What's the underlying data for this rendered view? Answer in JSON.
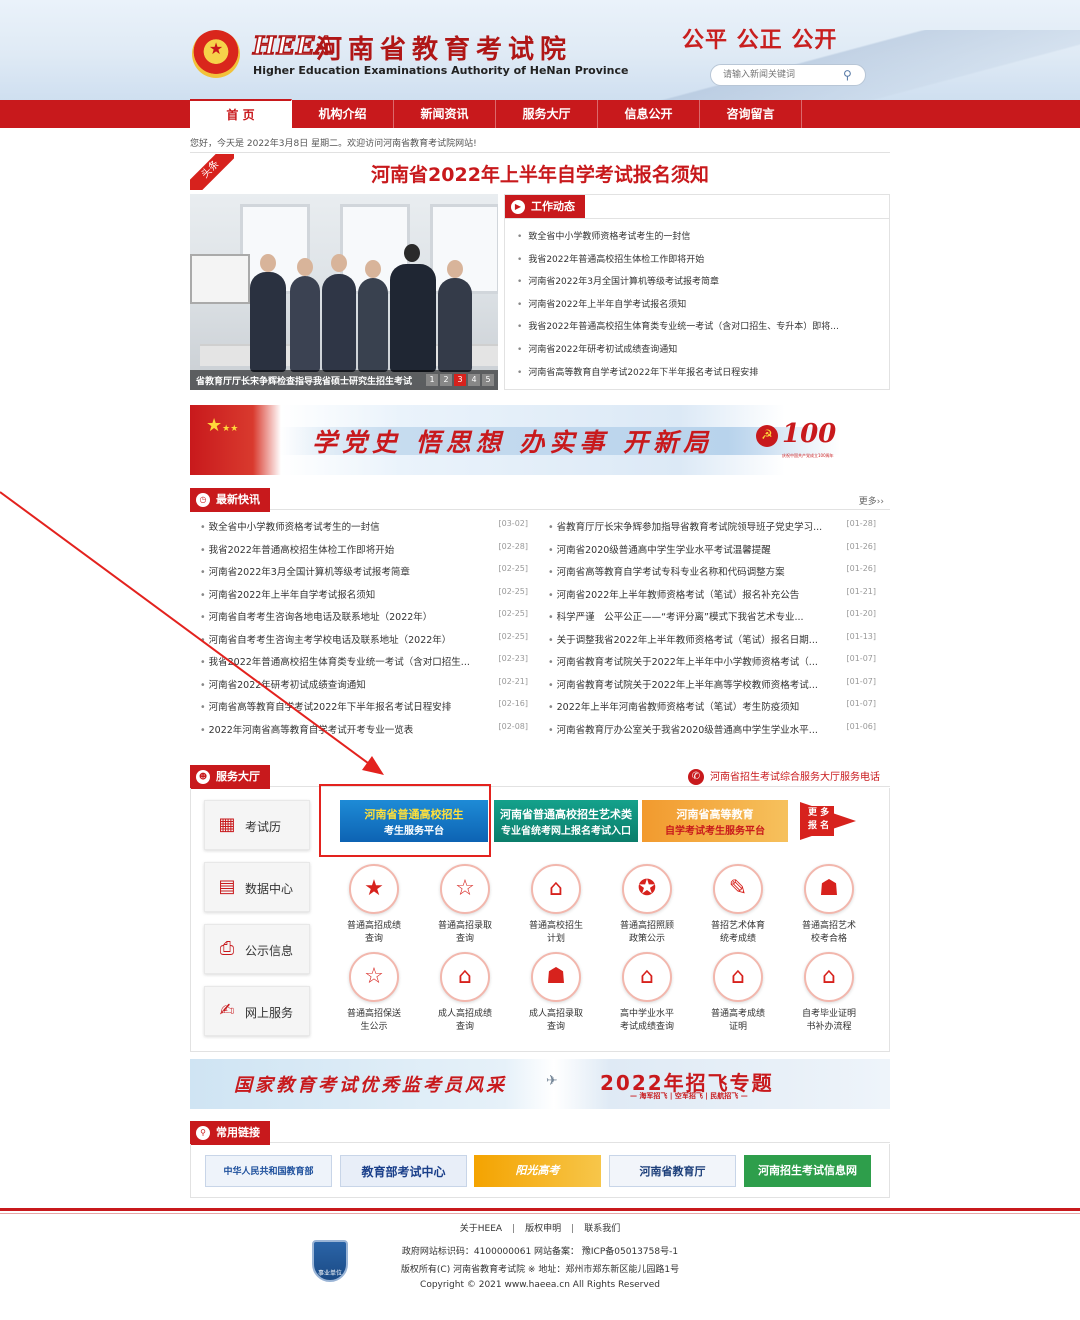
{
  "header": {
    "logo_abbr": "HEEA",
    "logo_cn": "河南省教育考试院",
    "logo_en": "Higher Education Examinations Authority of HeNan Province",
    "slogan": "公平 公正 公开",
    "search_placeholder": "请输入新闻关键词"
  },
  "nav": [
    "首 页",
    "机构介绍",
    "新闻资讯",
    "服务大厅",
    "信息公开",
    "咨询留言"
  ],
  "welcome": "您好，今天是 2022年3月8日 星期二。欢迎访问河南省教育考试院网站!",
  "headline": {
    "ribbon": "头条",
    "title": "河南省2022年上半年自学考试报名须知"
  },
  "slider": {
    "caption": "省教育厅厅长宋争辉检查指导我省硕士研究生招生考试",
    "pages": [
      "1",
      "2",
      "3",
      "4",
      "5"
    ],
    "active_page": 3
  },
  "work_news": {
    "title": "工作动态",
    "items": [
      "致全省中小学教师资格考试考生的一封信",
      "我省2022年普通高校招生体检工作即将开始",
      "河南省2022年3月全国计算机等级考试报考简章",
      "河南省2022年上半年自学考试报名须知",
      "我省2022年普通高校招生体育类专业统一考试（含对口招生、专升本）即将...",
      "河南省2022年研考初试成绩查询通知",
      "河南省高等教育自学考试2022年下半年报名考试日程安排"
    ]
  },
  "banner_slogan": "学党史 悟思想 办实事 开新局",
  "banner_badge": {
    "number": "100",
    "caption": "庆祝中国共产党成立100周年"
  },
  "latest_news": {
    "title": "最新快讯",
    "more": "更多››",
    "left": [
      {
        "title": "致全省中小学教师资格考试考生的一封信",
        "date": "[03-02]"
      },
      {
        "title": "我省2022年普通高校招生体检工作即将开始",
        "date": "[02-28]"
      },
      {
        "title": "河南省2022年3月全国计算机等级考试报考简章",
        "date": "[02-25]"
      },
      {
        "title": "河南省2022年上半年自学考试报名须知",
        "date": "[02-25]"
      },
      {
        "title": "河南省自考考生咨询各地电话及联系地址（2022年）",
        "date": "[02-25]"
      },
      {
        "title": "河南省自考考生咨询主考学校电话及联系地址（2022年）",
        "date": "[02-25]"
      },
      {
        "title": "我省2022年普通高校招生体育类专业统一考试（含对口招生...",
        "date": "[02-23]"
      },
      {
        "title": "河南省2022年研考初试成绩查询通知",
        "date": "[02-21]"
      },
      {
        "title": "河南省高等教育自学考试2022年下半年报名考试日程安排",
        "date": "[02-16]"
      },
      {
        "title": "2022年河南省高等教育自学考试开考专业一览表",
        "date": "[02-08]"
      }
    ],
    "right": [
      {
        "title": "省教育厅厅长宋争辉参加指导省教育考试院领导班子党史学习...",
        "date": "[01-28]"
      },
      {
        "title": "河南省2020级普通高中学生学业水平考试温馨提醒",
        "date": "[01-26]"
      },
      {
        "title": "河南省高等教育自学考试专科专业名称和代码调整方案",
        "date": "[01-26]"
      },
      {
        "title": "河南省2022年上半年教师资格考试（笔试）报名补充公告",
        "date": "[01-21]"
      },
      {
        "title": "科学严谨　公平公正——“考评分离”模式下我省艺术专业...",
        "date": "[01-20]"
      },
      {
        "title": "关于调整我省2022年上半年教师资格考试（笔试）报名日期...",
        "date": "[01-13]"
      },
      {
        "title": "河南省教育考试院关于2022年上半年中小学教师资格考试（...",
        "date": "[01-07]"
      },
      {
        "title": "河南省教育考试院关于2022年上半年高等学校教师资格考试...",
        "date": "[01-07]"
      },
      {
        "title": "2022年上半年河南省教师资格考试（笔试）考生防疫须知",
        "date": "[01-07]"
      },
      {
        "title": "河南省教育厅办公室关于我省2020级普通高中学生学业水平...",
        "date": "[01-06]"
      }
    ]
  },
  "service_hall": {
    "title": "服务大厅",
    "phone": "河南省招生考试综合服务大厅服务电话",
    "side_buttons": [
      "考试历",
      "数据中心",
      "公示信息",
      "网上服务"
    ],
    "platforms": [
      {
        "line1": "河南省普通高校招生",
        "line2": "考生服务平台"
      },
      {
        "line1": "河南省普通高校招生艺术类",
        "line2": "专业省统考网上报名考试入口"
      },
      {
        "line1": "河南省高等教育",
        "line2": "自学考试考生服务平台"
      }
    ],
    "more": "更 多 报 名",
    "services": [
      {
        "name1": "普通高招成绩",
        "name2": "查询",
        "icon": "star-icon"
      },
      {
        "name1": "普通高招录取",
        "name2": "查询",
        "icon": "star-outline-icon"
      },
      {
        "name1": "普通高校招生",
        "name2": "计划",
        "icon": "building-icon"
      },
      {
        "name1": "普通高招照顾",
        "name2": "政策公示",
        "icon": "star-icon"
      },
      {
        "name1": "普招艺术体育",
        "name2": "统考成绩",
        "icon": "edit-icon"
      },
      {
        "name1": "普通高招艺术",
        "name2": "校考合格",
        "icon": "group-icon"
      },
      {
        "name1": "普通高招保送",
        "name2": "生公示",
        "icon": "star-outline-icon"
      },
      {
        "name1": "成人高招成绩",
        "name2": "查询",
        "icon": "building-icon"
      },
      {
        "name1": "成人高招录取",
        "name2": "查询",
        "icon": "group-icon"
      },
      {
        "name1": "高中学业水平",
        "name2": "考试成绩查询",
        "icon": "building-icon"
      },
      {
        "name1": "普通高考成绩",
        "name2": "证明",
        "icon": "building-icon"
      },
      {
        "name1": "自考毕业证明",
        "name2": "书补办流程",
        "icon": "building-icon"
      }
    ]
  },
  "banner2": {
    "left": "国家教育考试优秀监考员风采",
    "right": "2022年招飞专题",
    "sub": "— 海军招飞 | 空军招飞 | 民航招飞 —"
  },
  "links": {
    "title": "常用链接",
    "items": [
      "中华人民共和国教育部",
      "教育部考试中心",
      "阳光高考",
      "河南省教育厅",
      "河南招生考试信息网"
    ]
  },
  "footer": {
    "nav": [
      "关于HEEA",
      "版权申明",
      "联系我们"
    ],
    "badge": "事业单位",
    "line1": "政府网站标识码：4100000061 网站备案：  豫ICP备05013758号-1",
    "line2": "版权所有(C) 河南省教育考试院 ※ 地址：郑州市郑东新区能儿园路1号",
    "line3": "Copyright © 2021 www.haeea.cn All Rights Reserved"
  },
  "colors": {
    "brand_red": "#c8191c",
    "highlight_red": "#e3221e"
  }
}
